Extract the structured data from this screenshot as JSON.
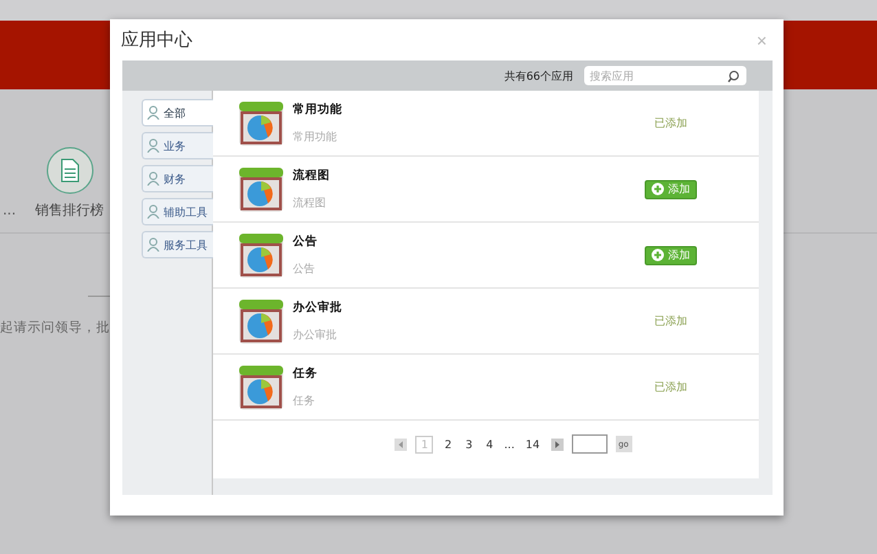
{
  "background": {
    "shortcut": {
      "label": "销售排行榜"
    },
    "ellipsis": "...",
    "notice": "起请示问领导，批"
  },
  "dialog": {
    "title": "应用中心",
    "close": "×",
    "count": "共有66个应用",
    "search": {
      "placeholder": "搜索应用"
    },
    "categories": [
      {
        "label": "全部",
        "selected": true
      },
      {
        "label": "业务",
        "selected": false
      },
      {
        "label": "财务",
        "selected": false
      },
      {
        "label": "辅助工具",
        "selected": false
      },
      {
        "label": "服务工具",
        "selected": false
      }
    ],
    "apps": [
      {
        "name": "常用功能",
        "description": "常用功能",
        "kind": "added",
        "action": "已添加"
      },
      {
        "name": "流程图",
        "description": "流程图",
        "kind": "add",
        "action": "添加"
      },
      {
        "name": "公告",
        "description": "公告",
        "kind": "add",
        "action": "添加"
      },
      {
        "name": "办公审批",
        "description": "办公审批",
        "kind": "added",
        "action": "已添加"
      },
      {
        "name": "任务",
        "description": "任务",
        "kind": "added",
        "action": "已添加"
      }
    ],
    "pagination": {
      "pages": [
        {
          "label": "1",
          "selected": true
        },
        {
          "label": "2",
          "selected": false
        },
        {
          "label": "3",
          "selected": false
        },
        {
          "label": "4",
          "selected": false
        }
      ],
      "gap": "...",
      "last": "14",
      "go": "go"
    }
  }
}
